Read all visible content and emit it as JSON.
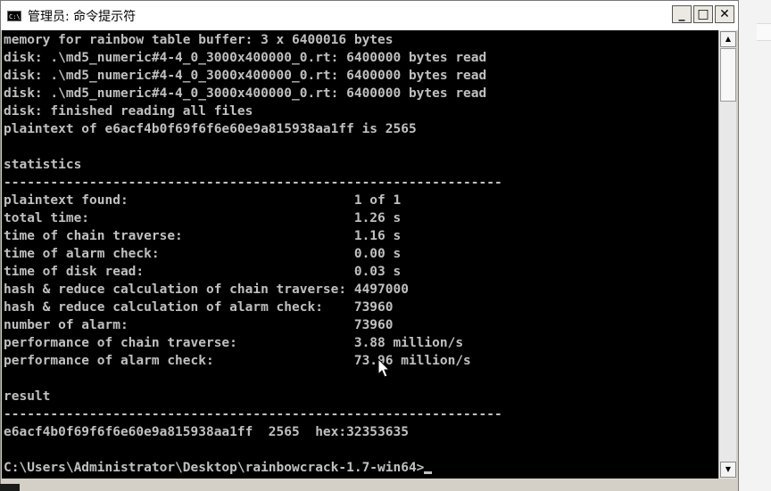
{
  "window": {
    "title": "管理员: 命令提示符",
    "icon_text": "C:\\",
    "controls": {
      "minimize": "_",
      "maximize": "□",
      "close": "✕"
    }
  },
  "console": {
    "lines": [
      "memory for rainbow table buffer: 3 x 6400016 bytes",
      "disk: .\\md5_numeric#4-4_0_3000x400000_0.rt: 6400000 bytes read",
      "disk: .\\md5_numeric#4-4_0_3000x400000_0.rt: 6400000 bytes read",
      "disk: .\\md5_numeric#4-4_0_3000x400000_0.rt: 6400000 bytes read",
      "disk: finished reading all files",
      "plaintext of e6acf4b0f69f6f6e60e9a815938aa1ff is 2565",
      "",
      "statistics",
      "----------------------------------------------------------------",
      "plaintext found:                             1 of 1",
      "total time:                                  1.26 s",
      "time of chain traverse:                      1.16 s",
      "time of alarm check:                         0.00 s",
      "time of disk read:                           0.03 s",
      "hash & reduce calculation of chain traverse: 4497000",
      "hash & reduce calculation of alarm check:    73960",
      "number of alarm:                             73960",
      "performance of chain traverse:               3.88 million/s",
      "performance of alarm check:                  73.96 million/s",
      "",
      "result",
      "----------------------------------------------------------------",
      "e6acf4b0f69f6f6e60e9a815938aa1ff  2565  hex:32353635",
      ""
    ],
    "prompt": "C:\\Users\\Administrator\\Desktop\\rainbowcrack-1.7-win64>"
  },
  "scrollbar": {
    "up_arrow": "▲",
    "down_arrow": "▼"
  },
  "colors": {
    "console_bg": "#000000",
    "console_fg": "#c0c0c0",
    "titlebar_bg": "#ffffff",
    "frame": "#d4d0c8"
  }
}
